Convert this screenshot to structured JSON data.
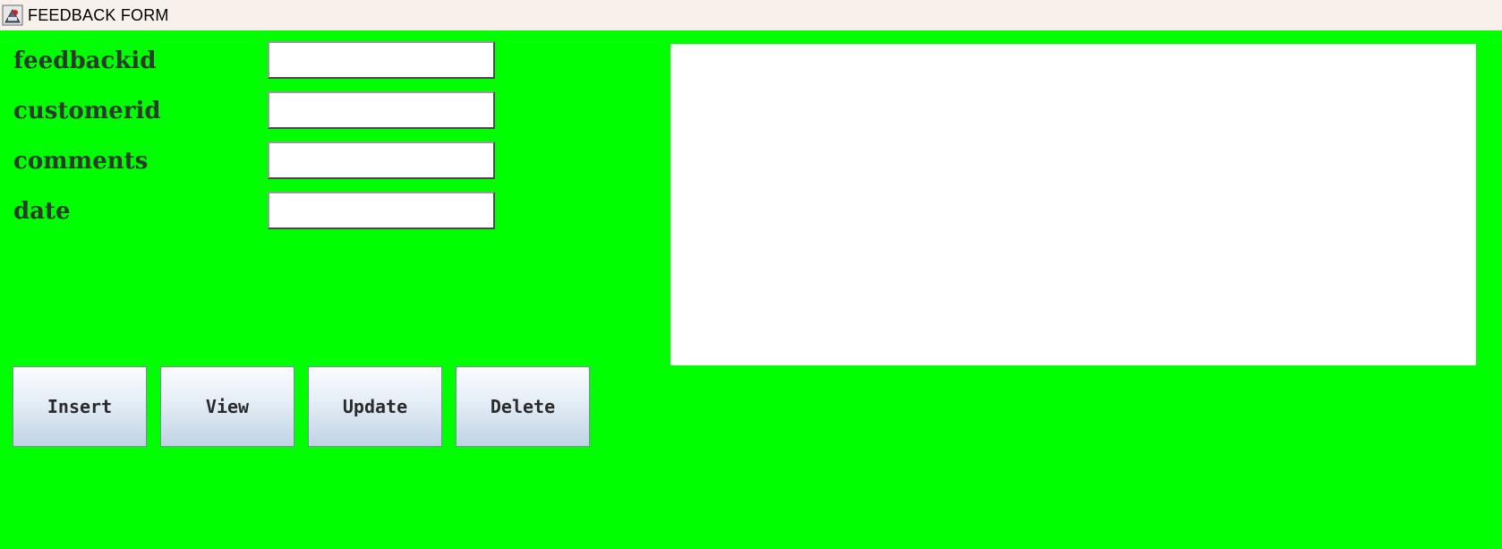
{
  "window": {
    "title": "FEEDBACK FORM",
    "app_icon": "java-app-icon"
  },
  "form": {
    "fields": [
      {
        "label": "feedbackid",
        "value": "",
        "placeholder": ""
      },
      {
        "label": "customerid",
        "value": "",
        "placeholder": ""
      },
      {
        "label": "comments",
        "value": "",
        "placeholder": ""
      },
      {
        "label": "date",
        "value": "",
        "placeholder": ""
      }
    ]
  },
  "buttons": {
    "insert": "Insert",
    "view": "View",
    "update": "Update",
    "delete": "Delete"
  },
  "output": {
    "text": ""
  },
  "colors": {
    "background": "#00ff00",
    "titlebar": "#f8f0ea",
    "label_text": "#2b3a2b",
    "output_background": "#ffffff"
  }
}
